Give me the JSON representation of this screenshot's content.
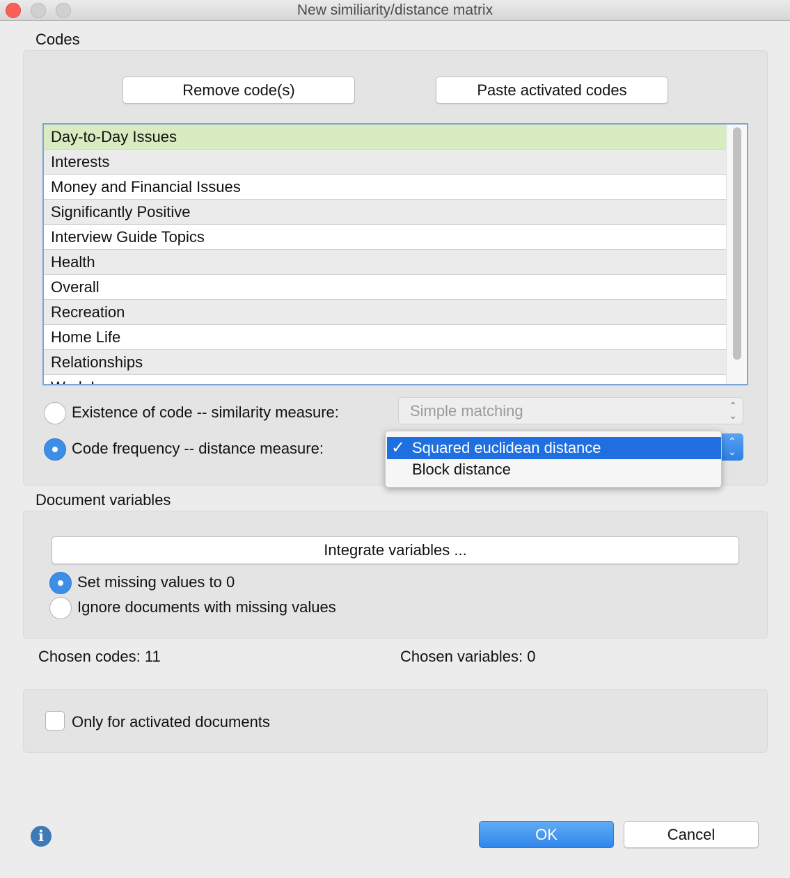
{
  "window": {
    "title": "New similiarity/distance matrix"
  },
  "codes": {
    "section_label": "Codes",
    "remove_button": "Remove code(s)",
    "paste_button": "Paste activated codes",
    "items": [
      "Day-to-Day Issues",
      "Interests",
      "Money and Financial Issues",
      "Significantly Positive",
      "Interview Guide Topics",
      "Health",
      "Overall",
      "Recreation",
      "Home Life",
      "Relationships",
      "Work Issues"
    ],
    "selected_item": "Day-to-Day Issues",
    "existence_label": "Existence of code -- similarity measure:",
    "existence_value": "Simple matching",
    "frequency_label": "Code frequency -- distance measure:",
    "distance_options": [
      "Squared euclidean distance",
      "Block distance"
    ],
    "distance_selected": "Squared euclidean distance"
  },
  "document_variables": {
    "section_label": "Document variables",
    "integrate_button": "Integrate variables ...",
    "set_missing_label": "Set missing values to 0",
    "ignore_label": "Ignore documents with missing values"
  },
  "status": {
    "chosen_codes": "Chosen codes: 11",
    "chosen_variables": "Chosen variables: 0"
  },
  "options": {
    "only_activated_label": "Only for activated documents"
  },
  "footer": {
    "ok_label": "OK",
    "cancel_label": "Cancel",
    "info_glyph": "i"
  },
  "colors": {
    "accent": "#2f86ea",
    "selected_row": "#d8ebc1",
    "menu_highlight": "#1f6fe0"
  }
}
